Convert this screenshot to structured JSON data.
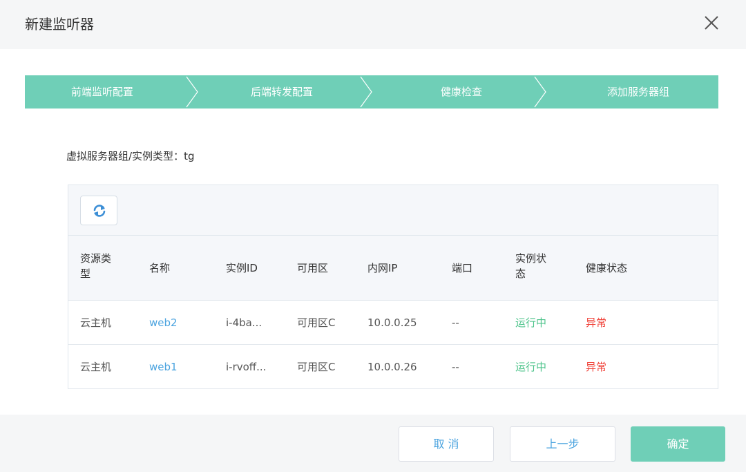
{
  "dialog": {
    "title": "新建监听器",
    "close_icon": "close-icon"
  },
  "steps": [
    {
      "label": "前端监听配置"
    },
    {
      "label": "后端转发配置"
    },
    {
      "label": "健康检查"
    },
    {
      "label": "添加服务器组"
    }
  ],
  "colors": {
    "accent": "#6fcfb7",
    "link": "#4aa3df",
    "running": "#4cc38a",
    "abnormal": "#f0433a"
  },
  "group_type": {
    "label": "虚拟服务器组/实例类型：",
    "value": "tg"
  },
  "toolbar": {
    "refresh_icon": "refresh-icon"
  },
  "table": {
    "headers": {
      "resource_type_line1": "资源类",
      "resource_type_line2": "型",
      "name": "名称",
      "instance_id": "实例ID",
      "zone": "可用区",
      "private_ip": "内网IP",
      "port": "端口",
      "instance_status_line1": "实例状",
      "instance_status_line2": "态",
      "health_status": "健康状态"
    },
    "rows": [
      {
        "resource_type": "云主机",
        "name": "web2",
        "instance_id": "i-4ba...",
        "zone": "可用区C",
        "private_ip": "10.0.0.25",
        "port": "--",
        "instance_status": "运行中",
        "health_status": "异常"
      },
      {
        "resource_type": "云主机",
        "name": "web1",
        "instance_id": "i-rvoff...",
        "zone": "可用区C",
        "private_ip": "10.0.0.26",
        "port": "--",
        "instance_status": "运行中",
        "health_status": "异常"
      }
    ]
  },
  "footer": {
    "cancel_label": "取 消",
    "prev_label": "上一步",
    "confirm_label": "确定"
  }
}
